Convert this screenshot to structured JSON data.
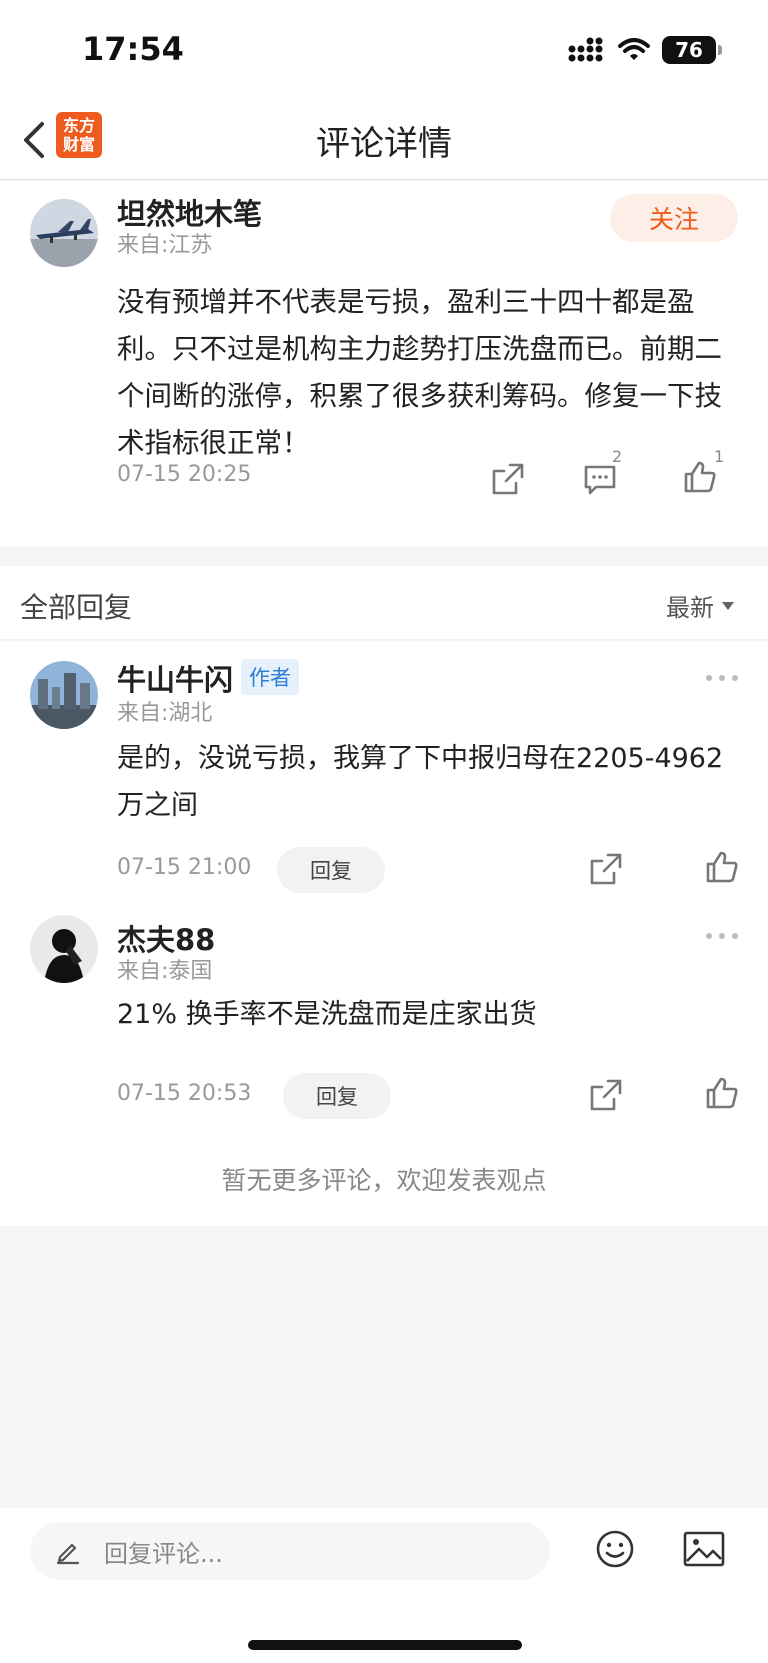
{
  "status_bar": {
    "time": "17:54",
    "battery": "76"
  },
  "nav": {
    "logo_line1": "东方",
    "logo_line2": "财富",
    "title": "评论详情"
  },
  "main_comment": {
    "user_name": "坦然地木笔",
    "location": "来自:江苏",
    "follow_label": "关注",
    "text": "没有预增并不代表是亏损，盈利三十四十都是盈利。只不过是机构主力趁势打压洗盘而已。前期二个间断的涨停，积累了很多获利筹码。修复一下技术指标很正常！",
    "time": "07-15 20:25",
    "comment_count": "2",
    "like_count": "1"
  },
  "replies_header": {
    "title": "全部回复",
    "sort_label": "最新"
  },
  "replies": [
    {
      "user_name": "牛山牛闪",
      "badge": "作者",
      "location": "来自:湖北",
      "text": "是的，没说亏损，我算了下中报归母在2205-4962万之间",
      "time": "07-15 21:00",
      "reply_label": "回复"
    },
    {
      "user_name": "杰夫88",
      "location": "来自:泰国",
      "text": "21% 换手率不是洗盘而是庄家出货",
      "time": "07-15 20:53",
      "reply_label": "回复"
    }
  ],
  "end_note": "暂无更多评论，欢迎发表观点",
  "bottom_bar": {
    "input_placeholder": "回复评论..."
  },
  "colors": {
    "accent": "#f05a1a",
    "badge_blue": "#2d7ed6",
    "background": "#f4f5f7"
  }
}
